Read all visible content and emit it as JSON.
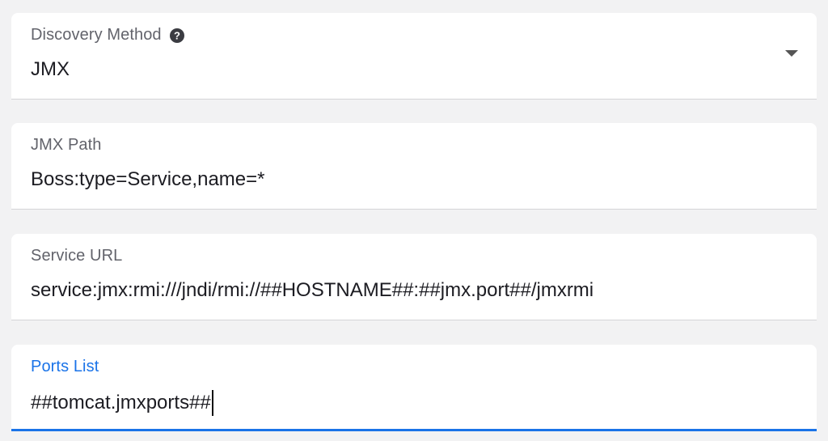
{
  "fields": [
    {
      "label": "Discovery Method",
      "value": "JMX",
      "help_icon": "question-circle-icon",
      "control": "select",
      "dropdown_icon": "caret-down-icon"
    },
    {
      "label": "JMX Path",
      "value": "Boss:type=Service,name=*"
    },
    {
      "label": "Service URL",
      "value": "service:jmx:rmi:///jndi/rmi://##HOSTNAME##:##jmx.port##/jmxrmi"
    },
    {
      "label": "Ports List",
      "value": "##tomcat.jmxports##",
      "focused": true
    }
  ],
  "colors": {
    "background": "#f2f2f3",
    "accent": "#1a73e8",
    "label": "#62636b",
    "value": "#1c1c22"
  }
}
